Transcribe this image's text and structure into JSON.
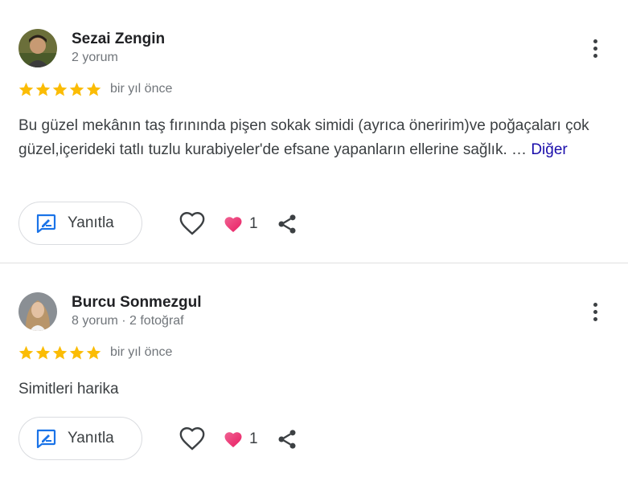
{
  "reviews": [
    {
      "name": "Sezai Zengin",
      "meta": "2 yorum",
      "rating": 5,
      "time": "bir yıl önce",
      "text": "Bu güzel mekânın taş fırınında pişen sokak simidi (ayrıca öneririm)ve poğaçaları çok güzel,içerideki tatlı tuzlu kurabiyeler'de efsane yapanların ellerine sağlık. …",
      "more": "Diğer",
      "reply_label": "Yanıtla",
      "reaction_count": "1"
    },
    {
      "name": "Burcu Sonmezgul",
      "meta": "8 yorum · 2 fotoğraf",
      "rating": 5,
      "time": "bir yıl önce",
      "text": "Simitleri harika",
      "more": "",
      "reply_label": "Yanıtla",
      "reaction_count": "1"
    }
  ],
  "colors": {
    "star": "#fbbc04",
    "accent_blue": "#1a73e8",
    "heart": "#ea4c89",
    "link": "#1a0dab"
  },
  "icons": {
    "menu": "more-vert-icon",
    "reply": "reply-icon",
    "like": "heart-outline-icon",
    "reaction": "heart-filled-icon",
    "share": "share-icon",
    "star": "star-icon"
  }
}
